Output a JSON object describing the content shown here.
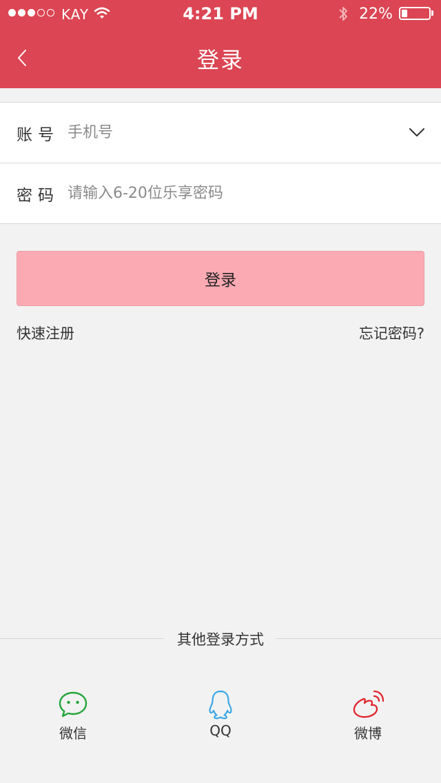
{
  "status_bar": {
    "carrier": "KAY",
    "time": "4:21 PM",
    "battery": "22%",
    "battery_level": 0.22,
    "signal_bars": 3,
    "signal_total": 5
  },
  "nav": {
    "title": "登录"
  },
  "form": {
    "account_label": "账号",
    "account_placeholder": "手机号",
    "password_label": "密码",
    "password_placeholder": "请输入6-20位乐享密码"
  },
  "actions": {
    "login_label": "登录",
    "register_label": "快速注册",
    "forgot_label": "忘记密码?"
  },
  "other_login": {
    "title": "其他登录方式",
    "wechat": "微信",
    "qq": "QQ",
    "weibo": "微博"
  },
  "colors": {
    "header": "#dc4553",
    "login_button": "#fbaab3",
    "wechat": "#25a53a",
    "qq": "#3aa7e6",
    "weibo": "#e0242b"
  }
}
